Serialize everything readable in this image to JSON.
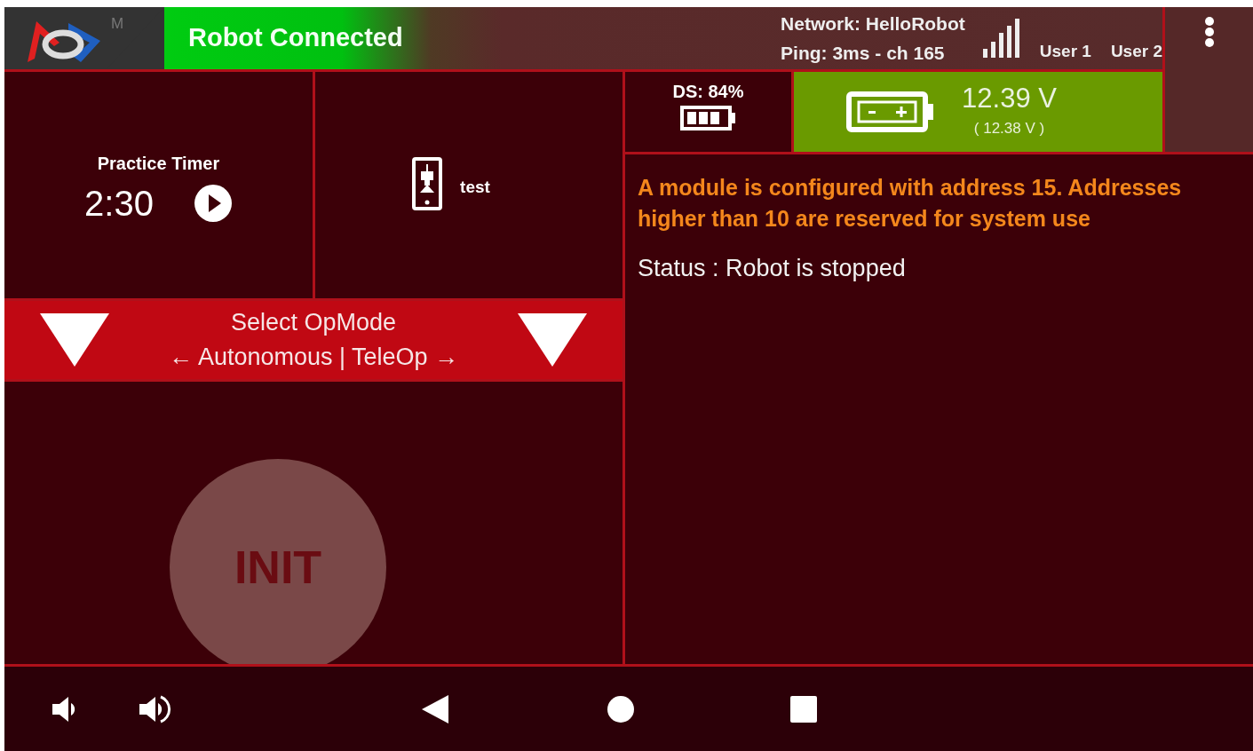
{
  "header": {
    "logo_letter": "M",
    "status": "Robot Connected",
    "network": "Network: HelloRobot",
    "ping": "Ping: 3ms - ch 165",
    "users": [
      "User 1",
      "User 2"
    ]
  },
  "ds": {
    "label": "DS: 84%"
  },
  "robot_battery": {
    "voltage": "12.39 V",
    "min_voltage": "( 12.38 V )"
  },
  "timer": {
    "label": "Practice Timer",
    "time": "2:30"
  },
  "active_config": {
    "name": "test"
  },
  "opmode": {
    "title": "Select OpMode",
    "subtitle": "← Autonomous | TeleOp →"
  },
  "init_button": {
    "label": "INIT"
  },
  "messages": [
    {
      "kind": "warning",
      "text": "A module is configured with address 15. Addresses higher than 10 are reserved for system use"
    },
    {
      "kind": "status",
      "text": "Status : Robot is stopped"
    }
  ]
}
